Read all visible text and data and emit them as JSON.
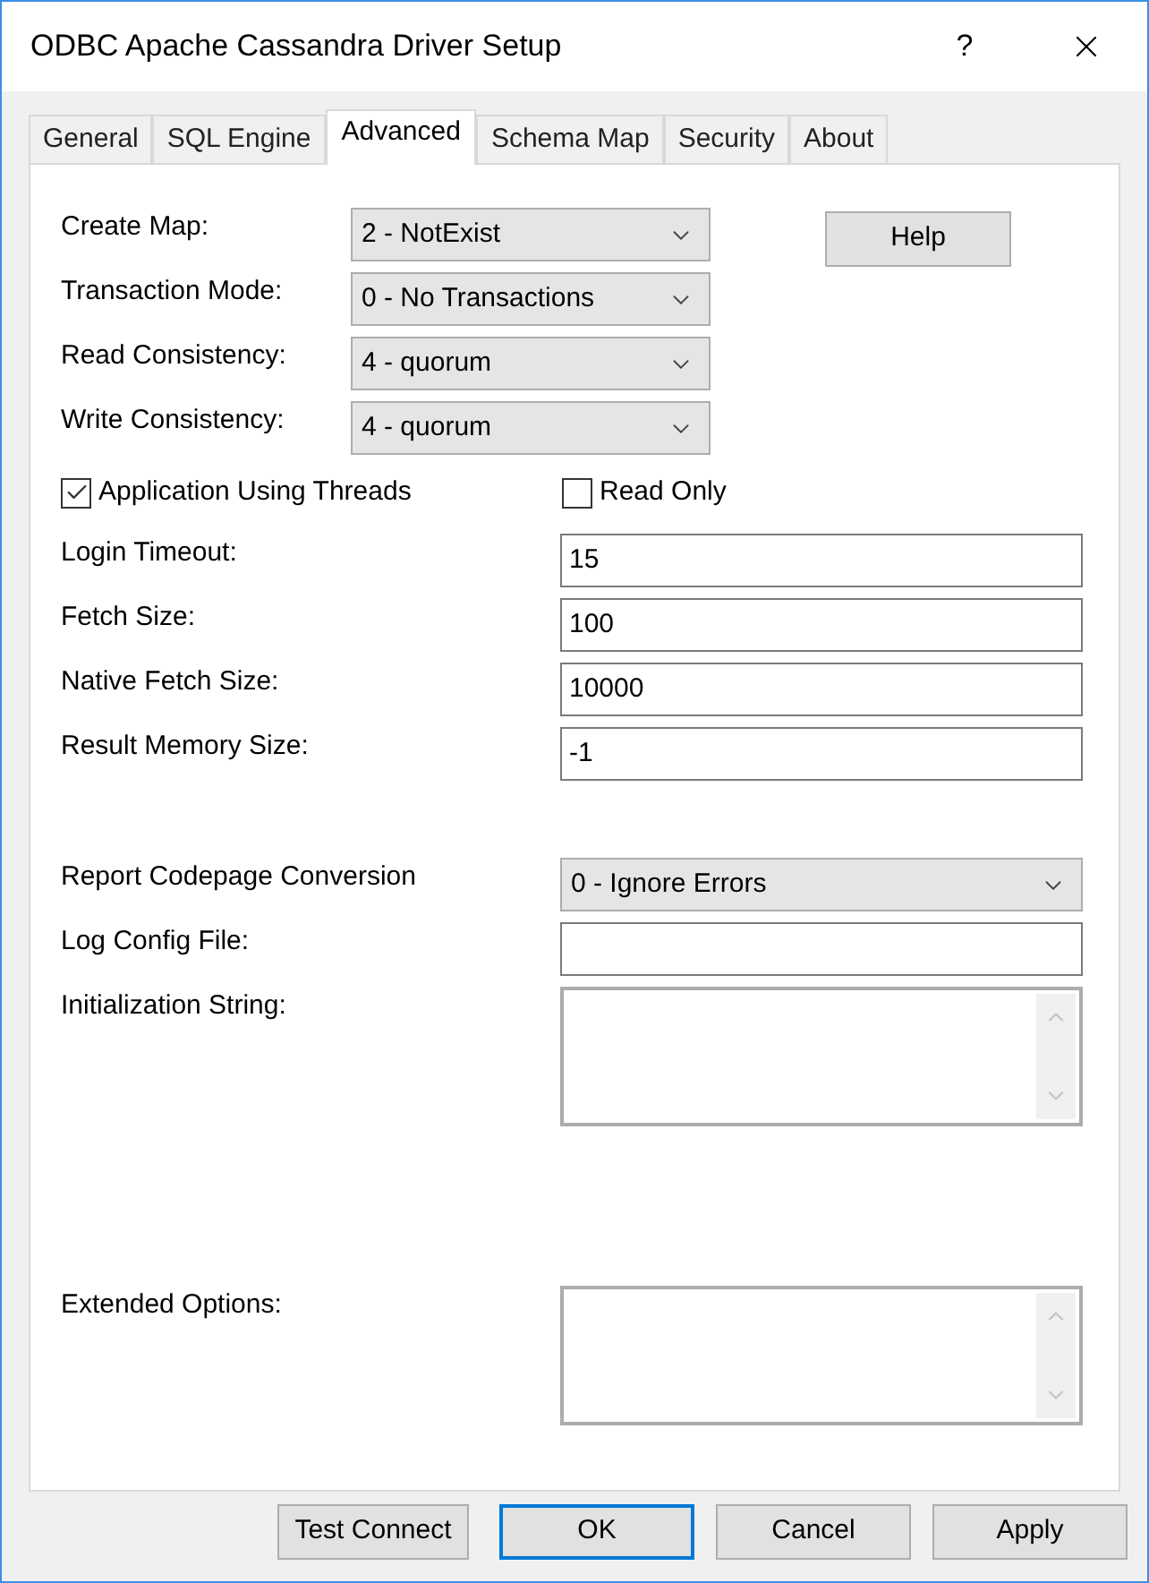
{
  "window": {
    "title": "ODBC Apache Cassandra Driver Setup",
    "help": "?"
  },
  "tabs": [
    {
      "label": "General",
      "selected": false
    },
    {
      "label": "SQL Engine",
      "selected": false
    },
    {
      "label": "Advanced",
      "selected": true
    },
    {
      "label": "Schema Map",
      "selected": false
    },
    {
      "label": "Security",
      "selected": false
    },
    {
      "label": "About",
      "selected": false
    }
  ],
  "dropdowns": [
    {
      "label": "Create Map:",
      "value": "2 - NotExist"
    },
    {
      "label": "Transaction Mode:",
      "value": "0 - No Transactions"
    },
    {
      "label": "Read Consistency:",
      "value": "4 - quorum"
    },
    {
      "label": "Write Consistency:",
      "value": "4 - quorum"
    }
  ],
  "help_button": "Help",
  "checkboxes": [
    {
      "label": "Application Using Threads",
      "checked": true
    },
    {
      "label": "Read Only",
      "checked": false
    }
  ],
  "fields": [
    {
      "label": "Login Timeout:",
      "value": "15",
      "kind": "text"
    },
    {
      "label": "Fetch Size:",
      "value": "100",
      "kind": "text"
    },
    {
      "label": "Native Fetch Size:",
      "value": "10000",
      "kind": "text"
    },
    {
      "label": "Result Memory Size:",
      "value": "-1",
      "kind": "text"
    },
    {
      "label": "Report Codepage Conversion",
      "value": "0 - Ignore Errors",
      "kind": "select"
    },
    {
      "label": "Log Config File:",
      "kind": "text"
    },
    {
      "label": "Initialization String:",
      "kind": "textarea"
    },
    {
      "label": "Extended Options:",
      "kind": "textarea"
    }
  ],
  "buttons": [
    {
      "label": "Test Connect",
      "default": false
    },
    {
      "label": "OK",
      "default": true
    },
    {
      "label": "Cancel",
      "default": false
    },
    {
      "label": "Apply",
      "default": false
    }
  ]
}
